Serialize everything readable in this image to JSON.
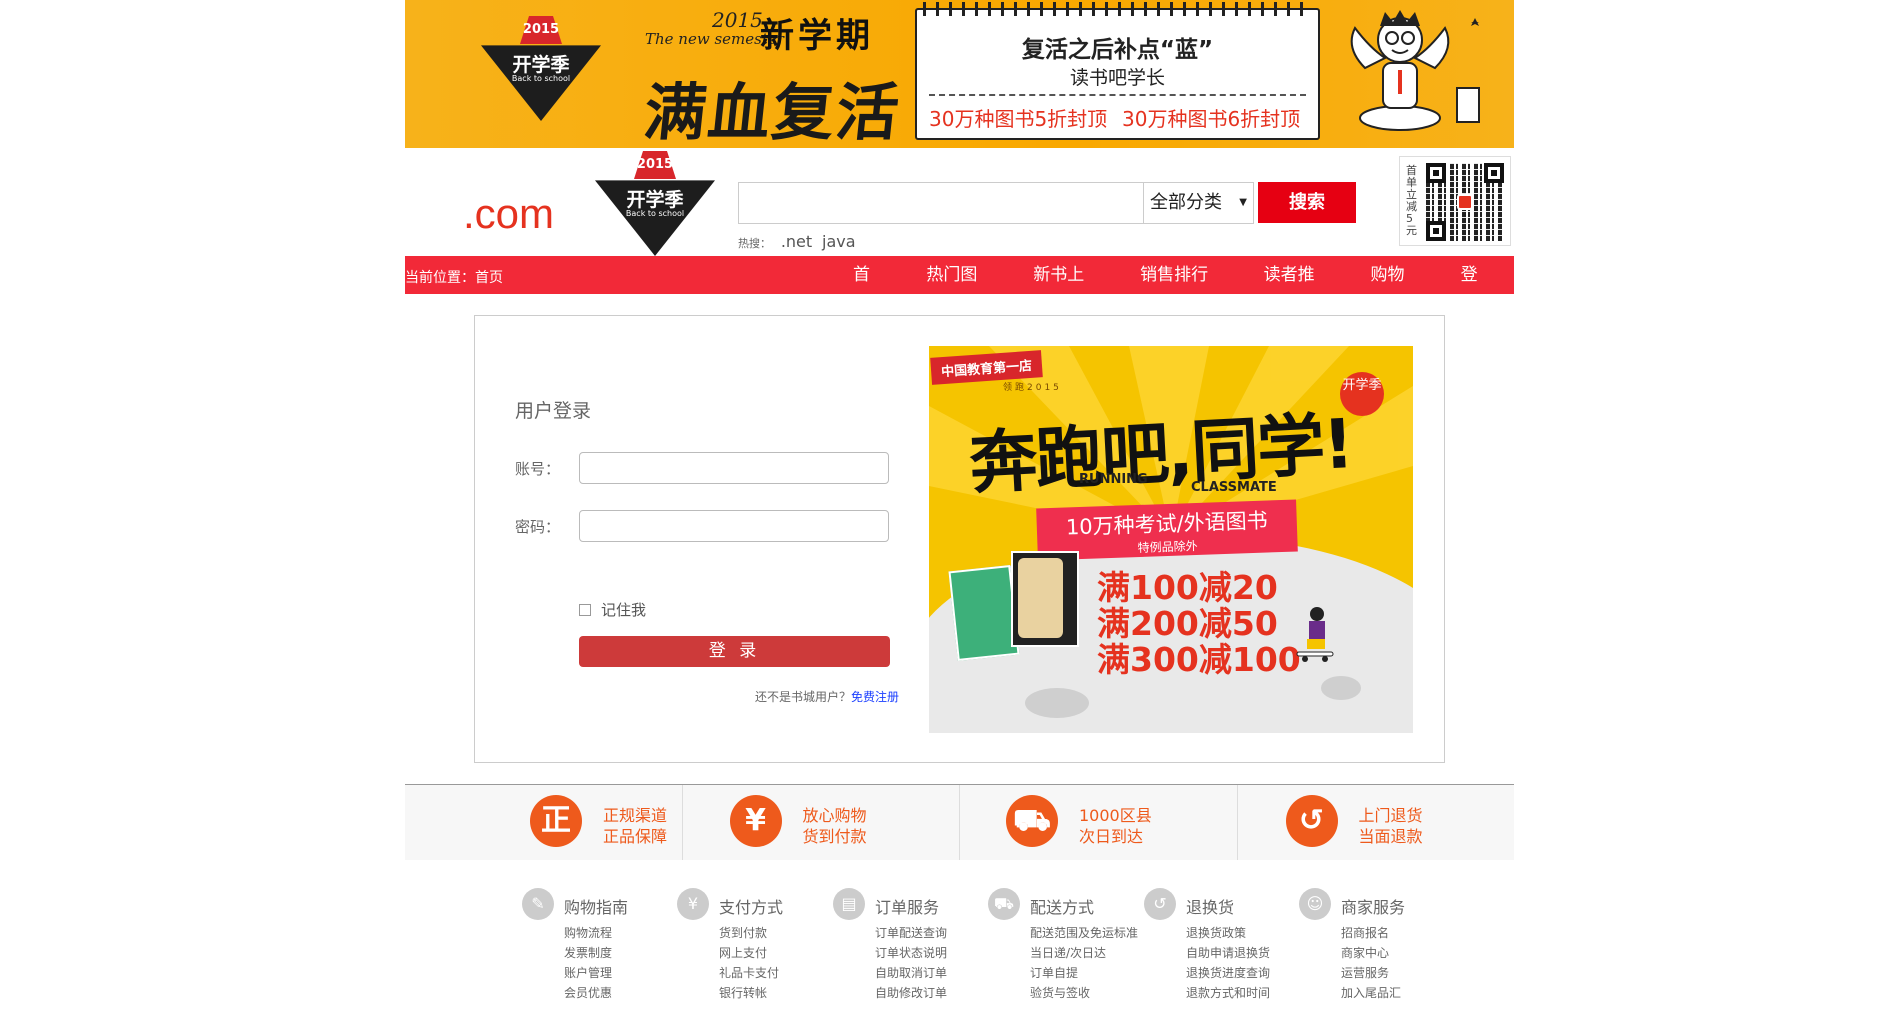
{
  "banner": {
    "badge_year": "2015",
    "badge_main": "开学季",
    "badge_sub": "Back to school",
    "semester_en": "The new semester",
    "semester_year": "2015",
    "semester_cn": "新学期",
    "slogan": "满血复活",
    "notebook_title": "复活之后补点“蓝”",
    "notebook_sub": "读书吧学长",
    "promo_1": "30万种图书5折封顶",
    "promo_2": "30万种图书6折封顶"
  },
  "header": {
    "logo_text": ".com",
    "badge_year": "2015",
    "badge_main": "开学季",
    "badge_sub": "Back to school",
    "search_placeholder": "",
    "category_selected": "全部分类",
    "search_button": "搜索",
    "hot_label": "热搜：",
    "hot_links": [
      ".net",
      "java"
    ],
    "qr_text": "首单立减5元"
  },
  "nav": {
    "breadcrumb": "当前位置：首页",
    "items": [
      "首页",
      "热门图书",
      "新书上架",
      "销售排行榜",
      "读者推荐",
      "购物车",
      "登录"
    ]
  },
  "login": {
    "title": "用户登录",
    "account_label": "账号：",
    "password_label": "密码：",
    "remember_label": "记住我",
    "submit_label": "登 录",
    "register_prompt": "还不是书城用户？",
    "register_link": "免费注册"
  },
  "promo": {
    "ribbon": "中国教育第一店",
    "ribbon_sub": "领跑2015",
    "badge": "开学季",
    "headline": "奔跑吧,同学!",
    "en_1": "RUNNING",
    "en_2": "CLASSMATE",
    "box_title": "10万种考试/外语图书",
    "box_sub": "特例品除外",
    "deals": [
      "满100减20",
      "满200减50",
      "满300减100"
    ]
  },
  "guarantees": [
    {
      "icon": "正",
      "line1": "正规渠道",
      "line2": "正品保障"
    },
    {
      "icon": "¥",
      "line1": "放心购物",
      "line2": "货到付款"
    },
    {
      "icon": "⛟",
      "line1": "1000区县",
      "line2": "次日到达"
    },
    {
      "icon": "↺",
      "line1": "上门退货",
      "line2": "当面退款"
    }
  ],
  "footer": [
    {
      "icon": "✎",
      "title": "购物指南",
      "links": [
        "购物流程",
        "发票制度",
        "账户管理",
        "会员优惠"
      ]
    },
    {
      "icon": "¥",
      "title": "支付方式",
      "links": [
        "货到付款",
        "网上支付",
        "礼品卡支付",
        "银行转帐"
      ]
    },
    {
      "icon": "▤",
      "title": "订单服务",
      "links": [
        "订单配送查询",
        "订单状态说明",
        "自助取消订单",
        "自助修改订单"
      ]
    },
    {
      "icon": "⛟",
      "title": "配送方式",
      "links": [
        "配送范围及免运标准",
        "当日递/次日达",
        "订单自提",
        "验货与签收"
      ]
    },
    {
      "icon": "↺",
      "title": "退换货",
      "links": [
        "退换货政策",
        "自助申请退换货",
        "退换货进度查询",
        "退款方式和时间"
      ]
    },
    {
      "icon": "☺",
      "title": "商家服务",
      "links": [
        "招商报名",
        "商家中心",
        "运营服务",
        "加入尾品汇"
      ]
    }
  ]
}
